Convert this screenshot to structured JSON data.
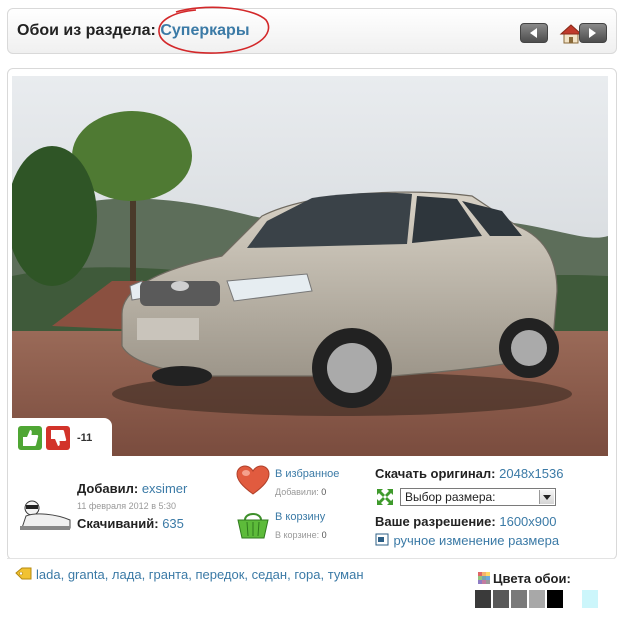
{
  "header": {
    "title_prefix": "Обои из раздела:",
    "section_link": "Суперкары",
    "icons": [
      "prev-arrow-icon",
      "home-icon",
      "next-arrow-icon"
    ]
  },
  "wallpaper": {
    "description": "Silver Lada Granta sedan on a brick pavement with misty green hills behind",
    "rating_score": "-11"
  },
  "uploader": {
    "added_label": "Добавил:",
    "user": "exsimer",
    "date": "11 февраля 2012 в 5:30",
    "downloads_label": "Скачиваний:",
    "downloads": "635"
  },
  "favorites": {
    "link": "В избранное",
    "count_label": "Добавили:",
    "count": "0"
  },
  "basket": {
    "link": "В корзину",
    "count_label": "В корзине:",
    "count": "0"
  },
  "download": {
    "original_label": "Скачать оригинал:",
    "original_size": "2048x1536",
    "size_select": "Выбор размера:",
    "resolution_label": "Ваше разрешение:",
    "resolution": "1600x900",
    "manual_resize": "ручное изменение размера"
  },
  "tags": [
    "lada",
    "granta",
    "лада",
    "гранта",
    "передок",
    "седан",
    "гора",
    "туман"
  ],
  "colors": {
    "title": "Цвета обои:",
    "swatches": [
      "#3a3a3a",
      "#595959",
      "#7a7a7a",
      "#a8a8a8",
      "#000000",
      "#ffffff",
      "#ccf6fb"
    ]
  },
  "palette": {
    "link_blue": "#3b7aa6",
    "annotation_red": "#d3282a"
  }
}
